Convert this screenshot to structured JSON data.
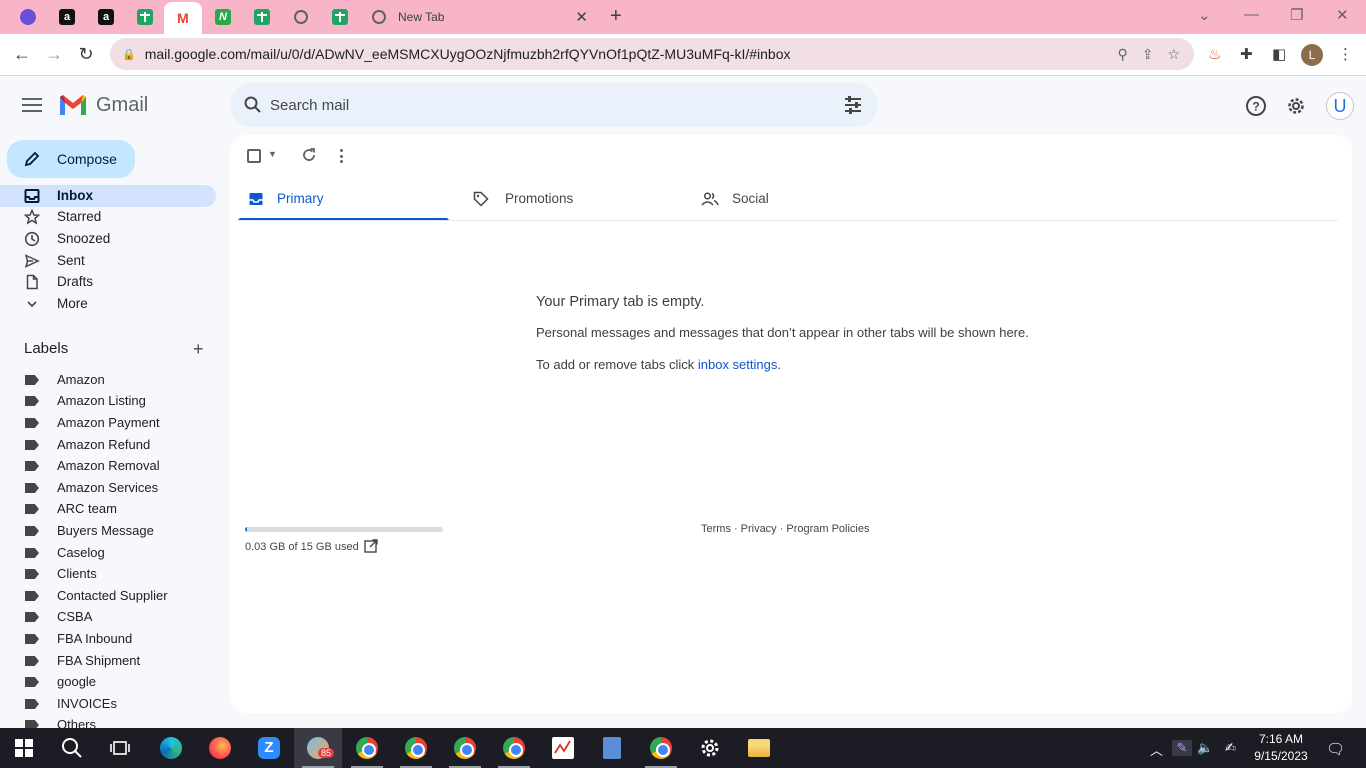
{
  "browser": {
    "tabs": [
      {
        "icon": "purple-circle-favicon",
        "text": ""
      },
      {
        "icon": "amazon-favicon",
        "text": "a"
      },
      {
        "icon": "amazon-favicon",
        "text": "a"
      },
      {
        "icon": "google-sheets-favicon",
        "text": ""
      },
      {
        "icon": "gmail-favicon",
        "text": "M"
      },
      {
        "icon": "wn-favicon",
        "text": "N"
      },
      {
        "icon": "google-sheets-favicon",
        "text": ""
      },
      {
        "icon": "globe-favicon",
        "text": ""
      },
      {
        "icon": "google-sheets-favicon",
        "text": ""
      }
    ],
    "new_tab_title": "New Tab",
    "url": "mail.google.com/mail/u/0/d/ADwNV_eeMSMCXUygOOzNjfmuzbh2rfQYVnOf1pQtZ-MU3uMFq-kI/#inbox",
    "profile_initial": "L"
  },
  "gmail": {
    "product_name": "Gmail",
    "search_placeholder": "Search mail",
    "account_initial": "U",
    "compose_label": "Compose",
    "nav": [
      {
        "label": "Inbox",
        "icon": "inbox-icon",
        "active": true
      },
      {
        "label": "Starred",
        "icon": "star-icon"
      },
      {
        "label": "Snoozed",
        "icon": "clock-icon"
      },
      {
        "label": "Sent",
        "icon": "send-icon"
      },
      {
        "label": "Drafts",
        "icon": "draft-icon"
      },
      {
        "label": "More",
        "icon": "chevron-down-icon"
      }
    ],
    "labels_heading": "Labels",
    "labels": [
      "Amazon",
      "Amazon Listing",
      "Amazon Payment",
      "Amazon Refund",
      "Amazon Removal",
      "Amazon Services",
      "ARC team",
      "Buyers Message",
      "Caselog",
      "Clients",
      "Contacted Supplier",
      "CSBA",
      "FBA Inbound",
      "FBA Shipment",
      "google",
      "INVOICEs",
      "Others"
    ],
    "category_tabs": [
      {
        "label": "Primary",
        "icon": "inbox-tab-icon",
        "active": true
      },
      {
        "label": "Promotions",
        "icon": "tag-icon"
      },
      {
        "label": "Social",
        "icon": "people-icon"
      }
    ],
    "empty_title": "Your Primary tab is empty.",
    "empty_desc": "Personal messages and messages that don’t appear in other tabs will be shown here.",
    "empty_hint_prefix": "To add or remove tabs click ",
    "empty_hint_link": "inbox settings",
    "empty_hint_suffix": ".",
    "storage_text": "0.03 GB of 15 GB used",
    "storage_fraction": 0.002,
    "footer": {
      "terms": "Terms",
      "privacy": "Privacy",
      "policies": "Program Policies",
      "sep": "·"
    }
  },
  "taskbar": {
    "badge": "85",
    "time": "7:16 AM",
    "date": "9/15/2023"
  }
}
